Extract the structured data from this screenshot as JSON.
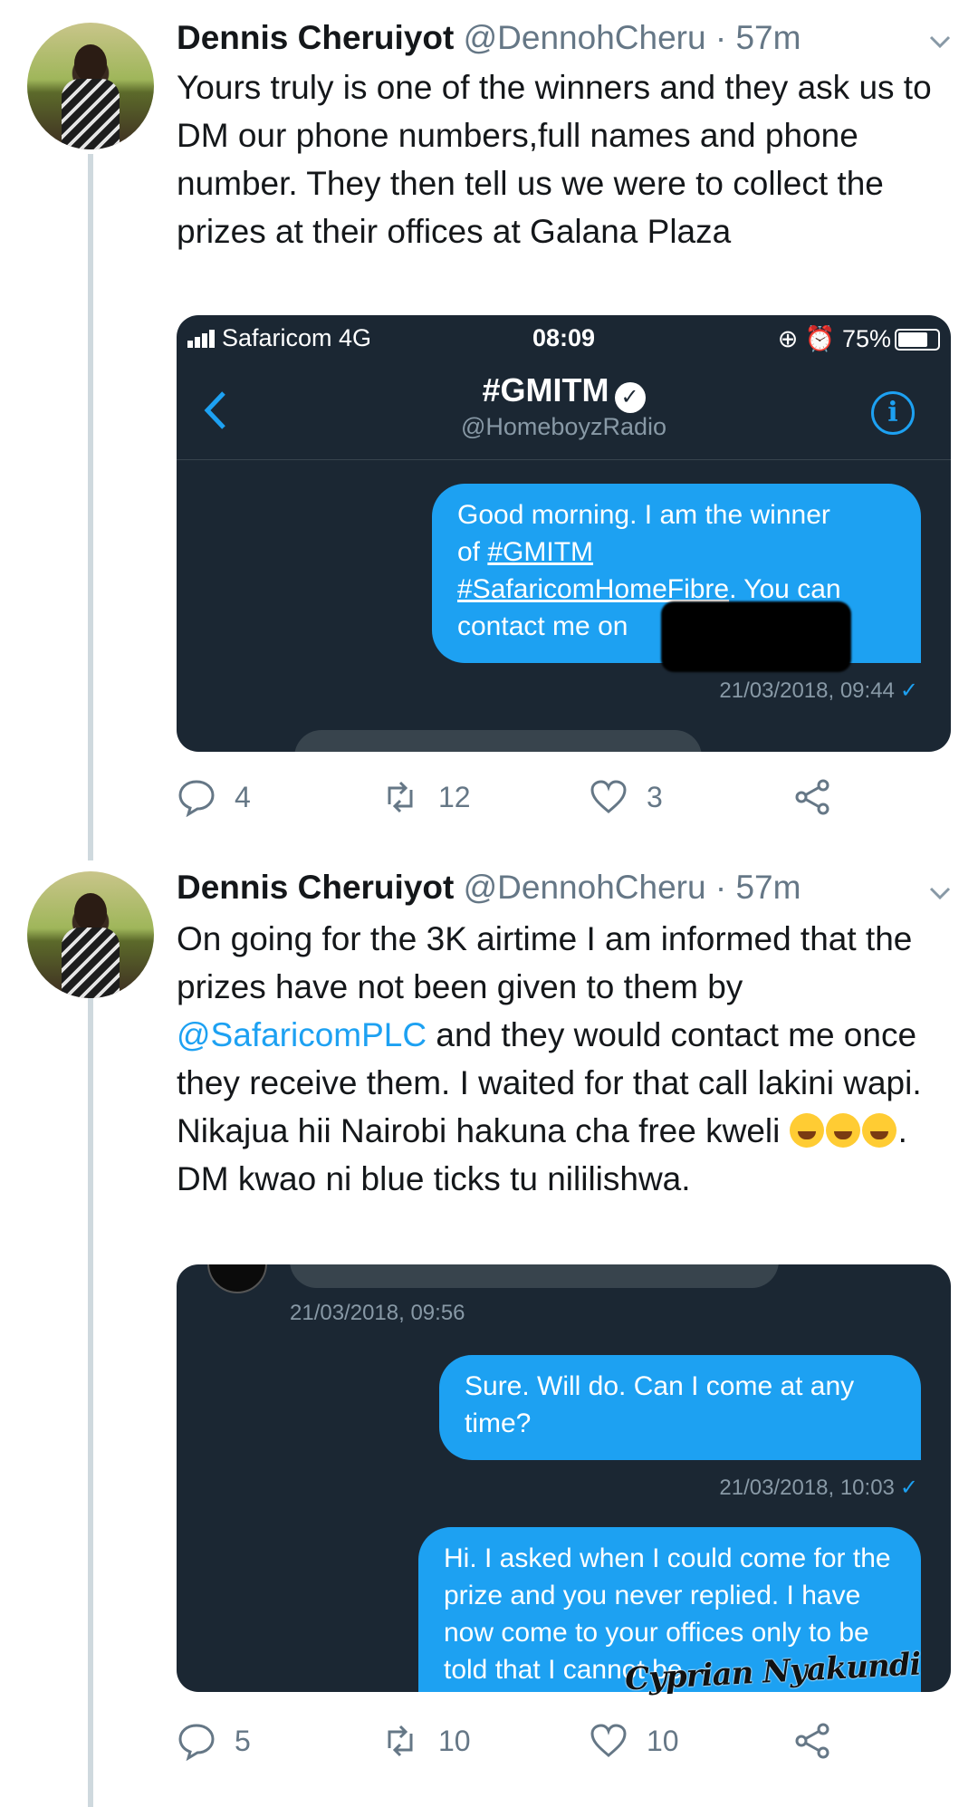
{
  "tweets": [
    {
      "display_name": "Dennis Cheruiyot",
      "handle": "@DennohCheru",
      "time": "· 57m",
      "text": "Yours truly is one of the winners and they ask us to DM our phone numbers,full names and phone number. They then tell us we were to collect the prizes at their offices at Galana Plaza",
      "media": {
        "status_bar": {
          "carrier": "Safaricom  4G",
          "time": "08:09",
          "battery": "75%"
        },
        "dm_title": "#GMITM",
        "dm_handle": "@HomeboyzRadio",
        "bubble": {
          "line1": "Good morning. I am the winner",
          "line2_prefix": "of ",
          "line2_link": "#GMITM",
          "line3_link": "#SafaricomHomeFibre",
          "line3_suffix": ". You can",
          "line4": "contact me on"
        },
        "timestamp": "21/03/2018, 09:44"
      },
      "actions": {
        "replies": "4",
        "retweets": "12",
        "likes": "3"
      }
    },
    {
      "display_name": "Dennis Cheruiyot",
      "handle": "@DennohCheru",
      "time": "· 57m",
      "text_part1": "On going for the 3K airtime I am informed that the prizes have not been given to them by ",
      "mention": "@SafaricomPLC",
      "text_part2": " and they would contact me once they receive them. I waited for that call lakini wapi. Nikajua hii Nairobi hakuna cha free kweli ",
      "text_part3": ". DM kwao ni blue ticks tu nililishwa.",
      "media": {
        "timestamp_top": "21/03/2018, 09:56",
        "bubble1": "Sure. Will do. Can I come at any time?",
        "timestamp_mid": "21/03/2018, 10:03",
        "bubble2": "Hi. I asked when I could come for the prize and you never replied. I have now come to your offices only to be told that I cannot be"
      },
      "actions": {
        "replies": "5",
        "retweets": "10",
        "likes": "10"
      }
    }
  ],
  "watermark": "Cyprian Nyakundi",
  "icons": {
    "reply": "reply-icon",
    "retweet": "retweet-icon",
    "like": "heart-icon",
    "share": "share-icon"
  },
  "colors": {
    "accent": "#1da1f2",
    "dark_bg": "#1b2733",
    "muted": "#657786"
  }
}
